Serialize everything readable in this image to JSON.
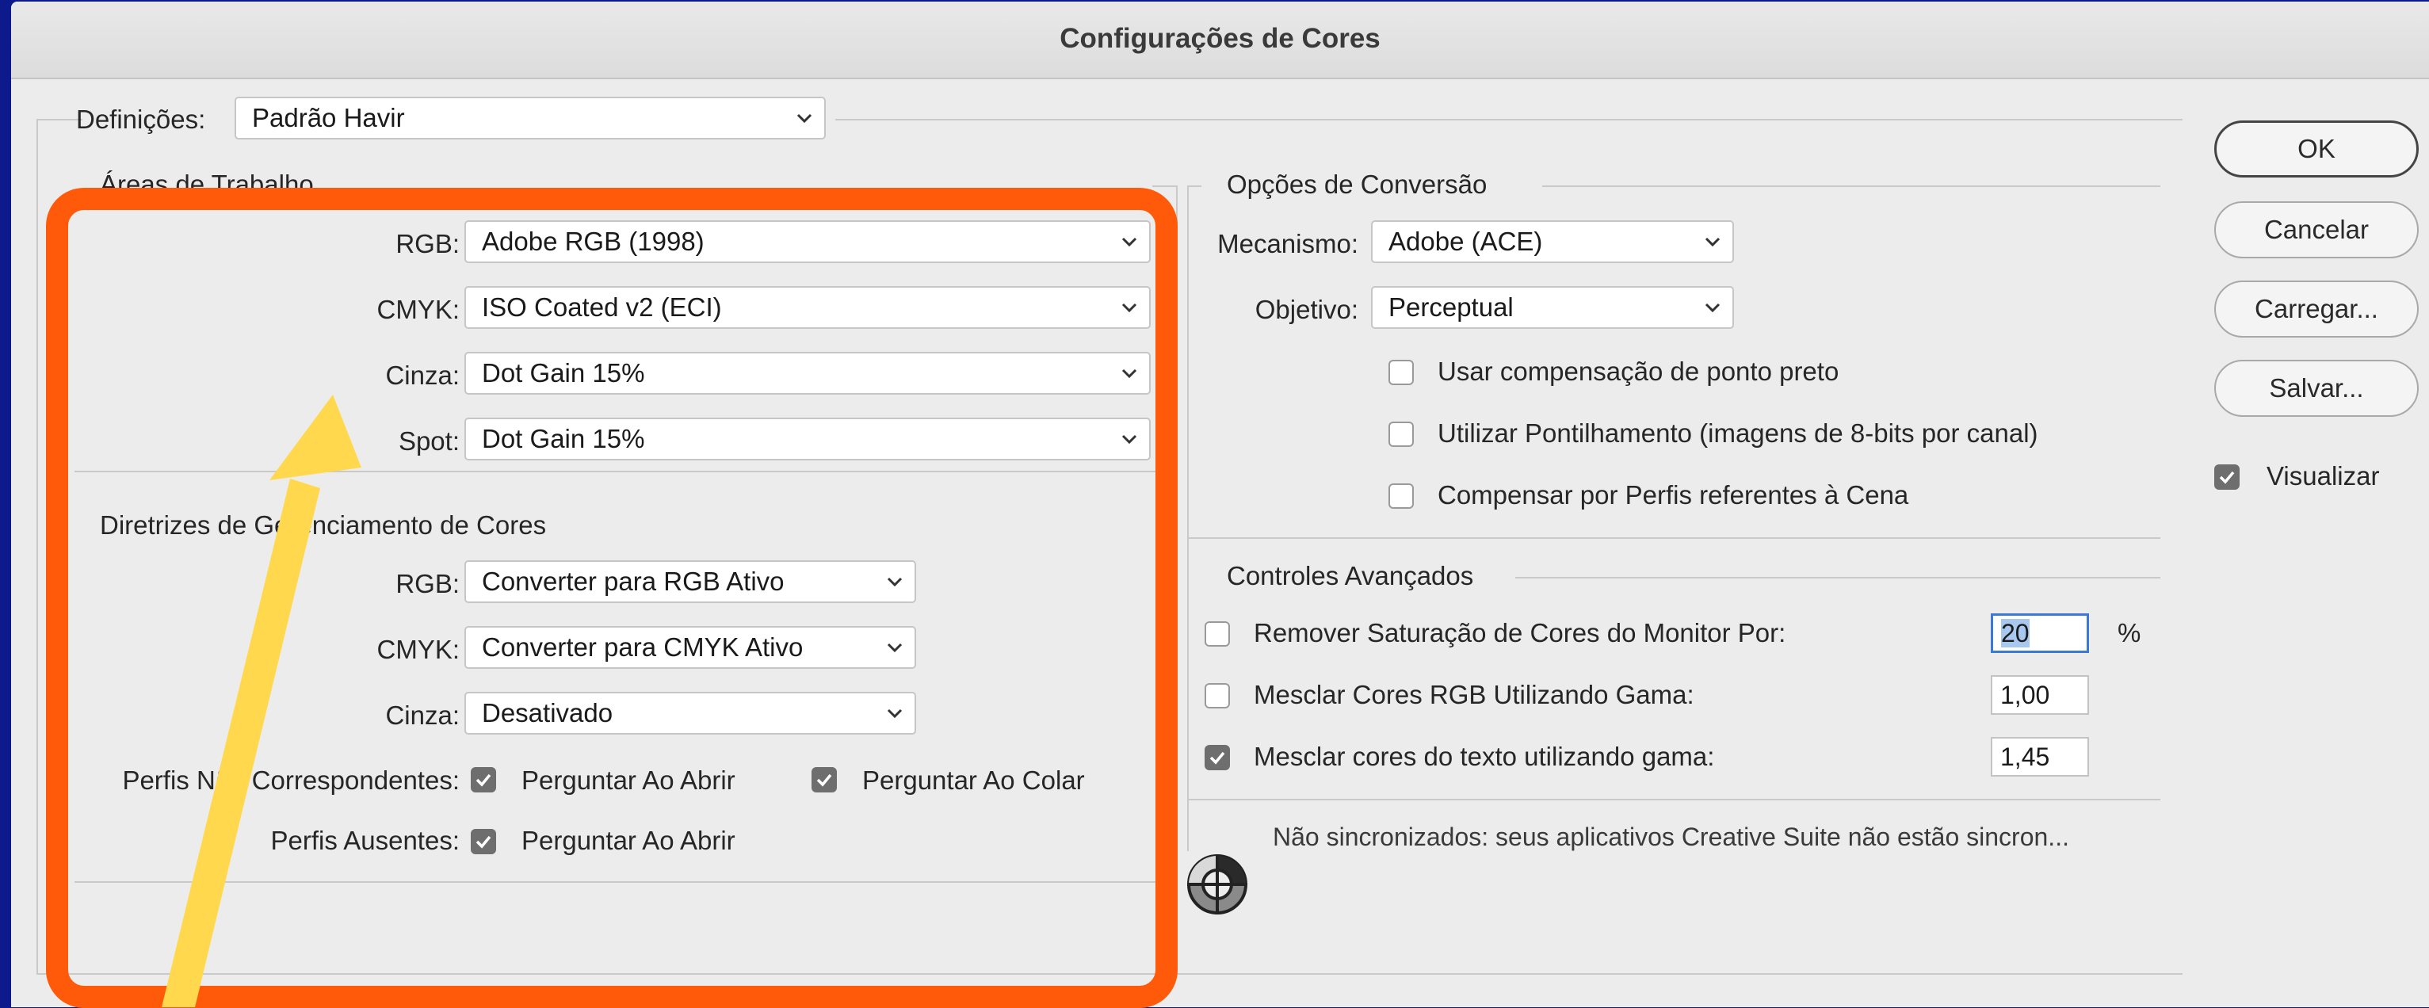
{
  "window": {
    "title": "Configurações de Cores"
  },
  "settings": {
    "label": "Definições:",
    "value": "Padrão Havir"
  },
  "workspaces": {
    "title": "Áreas de Trabalho",
    "rows": [
      {
        "label": "RGB:",
        "value": "Adobe RGB (1998)"
      },
      {
        "label": "CMYK:",
        "value": "ISO Coated v2 (ECI)"
      },
      {
        "label": "Cinza:",
        "value": "Dot Gain 15%"
      },
      {
        "label": "Spot:",
        "value": "Dot Gain 15%"
      }
    ]
  },
  "policies": {
    "title": "Diretrizes de Gerenciamento de Cores",
    "rows": [
      {
        "label": "RGB:",
        "value": "Converter para RGB Ativo"
      },
      {
        "label": "CMYK:",
        "value": "Converter para CMYK Ativo"
      },
      {
        "label": "Cinza:",
        "value": "Desativado"
      }
    ],
    "mismatch": {
      "label": "Perfis Não Correspondentes:",
      "ask_open": "Perguntar Ao Abrir",
      "ask_paste": "Perguntar Ao Colar",
      "ask_open_checked": true,
      "ask_paste_checked": true
    },
    "missing": {
      "label": "Perfis Ausentes:",
      "ask_open": "Perguntar Ao Abrir",
      "ask_open_checked": true
    }
  },
  "conversion": {
    "title": "Opções de Conversão",
    "engine": {
      "label": "Mecanismo:",
      "value": "Adobe (ACE)"
    },
    "intent": {
      "label": "Objetivo:",
      "value": "Perceptual"
    },
    "options": [
      {
        "label": "Usar compensação de ponto preto",
        "checked": false
      },
      {
        "label": "Utilizar Pontilhamento (imagens de 8-bits por canal)",
        "checked": false
      },
      {
        "label": "Compensar por Perfis referentes à Cena",
        "checked": false
      }
    ]
  },
  "advanced": {
    "title": "Controles Avançados",
    "desaturate": {
      "label": "Remover Saturação de Cores do Monitor Por:",
      "value": "20",
      "unit": "%",
      "checked": false
    },
    "blend_rgb": {
      "label": "Mesclar Cores RGB Utilizando Gama:",
      "value": "1,00",
      "checked": false
    },
    "blend_text": {
      "label": "Mesclar cores do texto utilizando gama:",
      "value": "1,45",
      "checked": true
    }
  },
  "sync_status": "Não sincronizados: seus aplicativos Creative Suite não estão sincron...",
  "buttons": {
    "ok": "OK",
    "cancel": "Cancelar",
    "load": "Carregar...",
    "save": "Salvar..."
  },
  "preview": {
    "label": "Visualizar",
    "checked": true
  },
  "colors": {
    "annotation_box": "#ff5a0a",
    "annotation_arrow": "#ffd84d",
    "background": "#0d1a8c",
    "focus": "#3b78d8"
  },
  "icons": {
    "sync": "sync-status-icon",
    "chevron": "chevron-down-icon",
    "check": "checkmark-icon"
  }
}
